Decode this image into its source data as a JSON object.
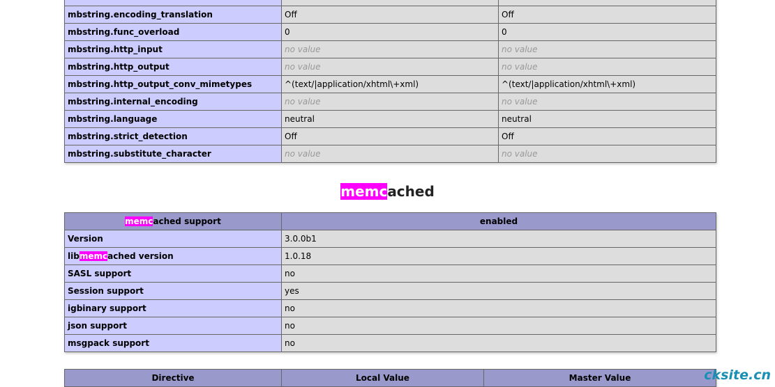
{
  "mbstring": {
    "rows": [
      {
        "name": "mbstring.encoding_translation",
        "local": "Off",
        "master": "Off",
        "nv": false
      },
      {
        "name": "mbstring.func_overload",
        "local": "0",
        "master": "0",
        "nv": false
      },
      {
        "name": "mbstring.http_input",
        "local": "no value",
        "master": "no value",
        "nv": true
      },
      {
        "name": "mbstring.http_output",
        "local": "no value",
        "master": "no value",
        "nv": true
      },
      {
        "name": "mbstring.http_output_conv_mimetypes",
        "local": "^(text/|application/xhtml\\+xml)",
        "master": "^(text/|application/xhtml\\+xml)",
        "nv": false
      },
      {
        "name": "mbstring.internal_encoding",
        "local": "no value",
        "master": "no value",
        "nv": true
      },
      {
        "name": "mbstring.language",
        "local": "neutral",
        "master": "neutral",
        "nv": false
      },
      {
        "name": "mbstring.strict_detection",
        "local": "Off",
        "master": "Off",
        "nv": false
      },
      {
        "name": "mbstring.substitute_character",
        "local": "no value",
        "master": "no value",
        "nv": true
      }
    ]
  },
  "memcached": {
    "title_hl": "memc",
    "title_rest": "ached",
    "support_header_hl": "memc",
    "support_header_rest": "ached support",
    "support_value": "enabled",
    "rows": [
      {
        "name": "Version",
        "value": "3.0.0b1"
      },
      {
        "name_pre": "lib",
        "name_hl": "memc",
        "name_post": "ached version",
        "value": "1.0.18"
      },
      {
        "name": "SASL support",
        "value": "no"
      },
      {
        "name": "Session support",
        "value": "yes"
      },
      {
        "name": "igbinary support",
        "value": "no"
      },
      {
        "name": "json support",
        "value": "no"
      },
      {
        "name": "msgpack support",
        "value": "no"
      }
    ],
    "directive_header": "Directive",
    "local_header": "Local Value",
    "master_header": "Master Value"
  },
  "watermark": "cksite.cn"
}
